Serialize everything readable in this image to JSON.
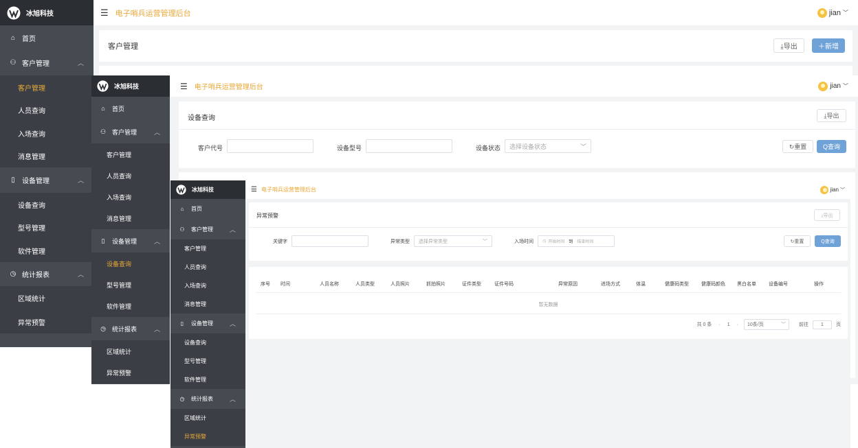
{
  "brand": "冰旭科技",
  "app_title": "电子哨兵运营管理后台",
  "user": "jian",
  "nav": {
    "home": "首页",
    "customer": "客户管理",
    "customer_items": [
      "客户管理",
      "人员查询",
      "入场查询",
      "消息管理"
    ],
    "device": "设备管理",
    "device_items": [
      "设备查询",
      "型号管理",
      "软件管理"
    ],
    "stats": "统计报表",
    "stats_items": [
      "区域统计",
      "异常预警"
    ]
  },
  "window1": {
    "page_title": "客户管理",
    "export_label": "⤓导出",
    "add_label": "＋新增"
  },
  "window2": {
    "page_title": "设备查询",
    "export_label": "⤓导出",
    "filters": {
      "customer_code_label": "客户代号",
      "device_model_label": "设备型号",
      "device_status_label": "设备状态",
      "device_status_placeholder": "选择设备状态"
    },
    "reset_label": "↻重置",
    "query_label": "Q查询"
  },
  "window3": {
    "page_title": "异常预警",
    "export_label": "⤓导出",
    "filters": {
      "keyword_label": "关键字",
      "anomaly_type_label": "异常类型",
      "anomaly_type_placeholder": "选择异常类型",
      "entry_time_label": "入场时间",
      "start_placeholder": "开始时间",
      "to_label": "到",
      "end_placeholder": "结束时间"
    },
    "reset_label": "↻重置",
    "query_label": "Q查询",
    "table": {
      "columns": [
        "序号",
        "时间",
        "人员名称",
        "人员类型",
        "人员照片",
        "抓拍照片",
        "证件类型",
        "证件号码",
        "异常原因",
        "进场方式",
        "体温",
        "健康码类型",
        "健康码颜色",
        "黑白名单",
        "设备编号",
        "操作"
      ],
      "empty_text": "暂无数据"
    },
    "pagination": {
      "total": "共 0 条",
      "prev": "‹",
      "page": "1",
      "next": "›",
      "page_size": "10条/页",
      "goto_label": "前往",
      "goto_value": "1",
      "page_unit": "页"
    }
  },
  "colors": {
    "sidebar_bg": "#464b52",
    "logo_bg": "#2b2f33",
    "accent": "#e8a838",
    "primary_button": "#6fa3d8"
  }
}
